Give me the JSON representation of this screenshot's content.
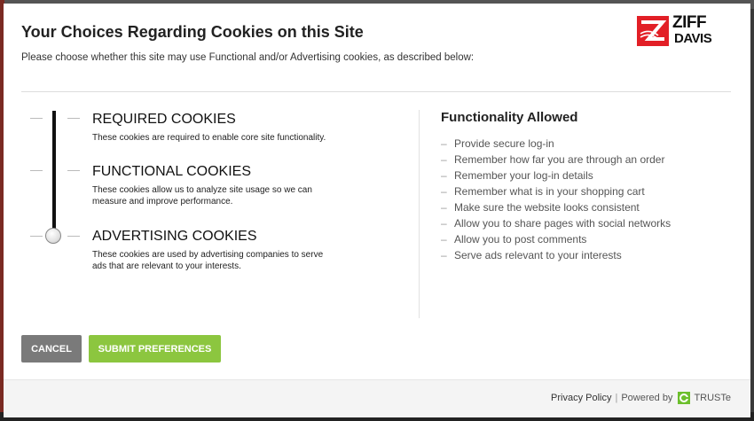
{
  "modal": {
    "title": "Your Choices Regarding Cookies on this Site",
    "subtitle": "Please choose whether this site may use Functional and/or Advertising cookies, as described below:"
  },
  "logo": {
    "line1": "ZIFF",
    "line2": "DAVIS",
    "brand_color": "#e21f26"
  },
  "levels": [
    {
      "title": "REQUIRED COOKIES",
      "description": "These cookies are required to enable core site functionality."
    },
    {
      "title": "FUNCTIONAL COOKIES",
      "description": "These cookies allow us to analyze site usage so we can measure and improve performance."
    },
    {
      "title": "ADVERTISING COOKIES",
      "description": "These cookies are used by advertising companies to serve ads that are relevant to your interests."
    }
  ],
  "selected_level": "ADVERTISING COOKIES",
  "allowed": {
    "title": "Functionality Allowed",
    "items": [
      "Provide secure log-in",
      "Remember how far you are through an order",
      "Remember your log-in details",
      "Remember what is in your shopping cart",
      "Make sure the website looks consistent",
      "Allow you to share pages with social networks",
      "Allow you to post comments",
      "Serve ads relevant to your interests"
    ]
  },
  "buttons": {
    "cancel": "CANCEL",
    "submit": "SUBMIT PREFERENCES",
    "cancel_color": "#7a7a7a",
    "submit_color": "#8cc63f"
  },
  "footer": {
    "privacy": "Privacy Policy",
    "separator": "|",
    "powered": "Powered by",
    "truste": "TRUSTe"
  }
}
